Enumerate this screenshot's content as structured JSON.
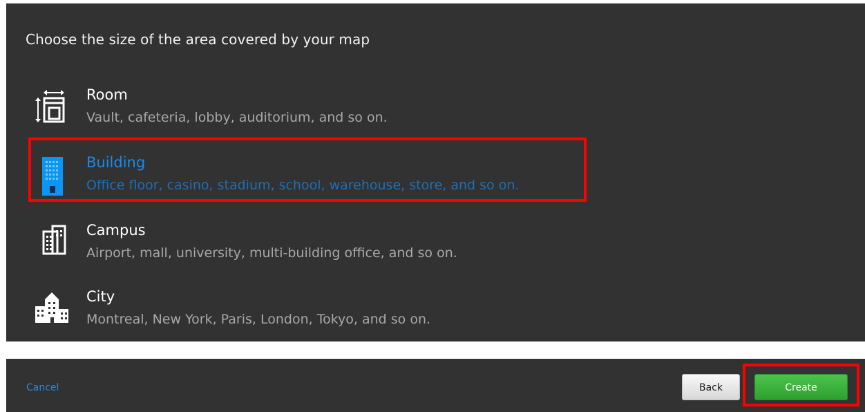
{
  "dialog": {
    "heading": "Choose the size of the area covered by your map",
    "options": [
      {
        "title": "Room",
        "description": "Vault, cafeteria, lobby, auditorium, and so on.",
        "icon": "room-icon",
        "selected": false
      },
      {
        "title": "Building",
        "description": "Office floor, casino, stadium, school, warehouse, store, and so on.",
        "icon": "building-icon",
        "selected": true
      },
      {
        "title": "Campus",
        "description": "Airport, mall, university, multi-building office, and so on.",
        "icon": "campus-icon",
        "selected": false
      },
      {
        "title": "City",
        "description": "Montreal, New York, Paris, London, Tokyo, and so on.",
        "icon": "city-icon",
        "selected": false
      }
    ]
  },
  "footer": {
    "cancel_label": "Cancel",
    "back_label": "Back",
    "create_label": "Create"
  },
  "colors": {
    "panel_background": "#323232",
    "selected_title": "#1a8be8",
    "selected_icon": "#0b95f5",
    "create_button": "#3cb33c",
    "annotation_box": "#ff0000"
  }
}
